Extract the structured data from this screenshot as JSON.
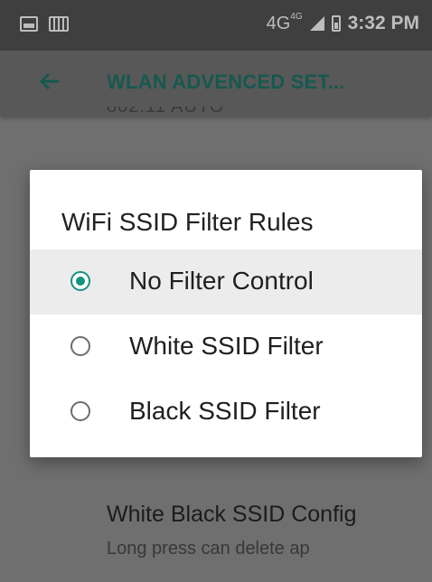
{
  "status_bar": {
    "network": "4G",
    "network_sup": "4G",
    "time": "3:32 PM",
    "icons": [
      "image-icon",
      "sim-card-icon",
      "signal-icon",
      "battery-icon"
    ]
  },
  "app_bar": {
    "title": "WLAN ADVENCED SET...",
    "back_icon": "arrow-left-icon",
    "title_color": "#16584f"
  },
  "background": {
    "partial_text": "802.11 AUTO",
    "item_title": "White Black SSID Config",
    "item_subtitle": "Long press can delete ap"
  },
  "dialog": {
    "title": "WiFi SSID Filter Rules",
    "accent_color": "#159382",
    "options": [
      {
        "label": "No Filter Control",
        "selected": true
      },
      {
        "label": "White SSID Filter",
        "selected": false
      },
      {
        "label": "Black SSID Filter",
        "selected": false
      }
    ]
  }
}
